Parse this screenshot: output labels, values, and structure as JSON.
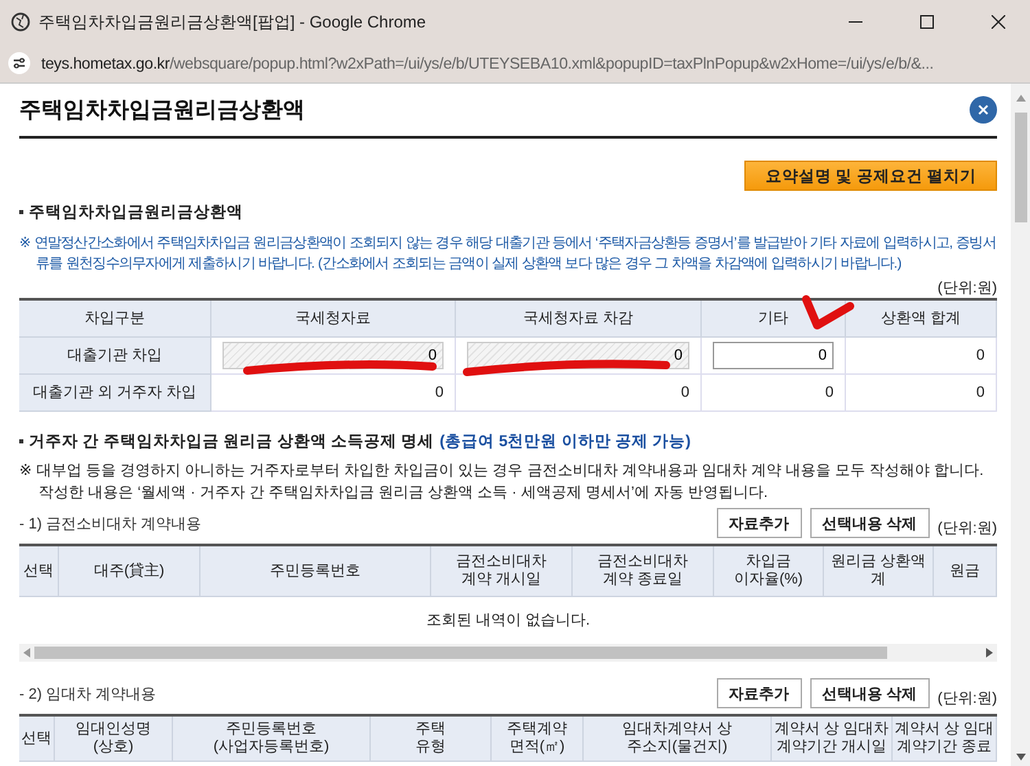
{
  "window": {
    "title": "주택임차차입금원리금상환액[팝업] - Google Chrome",
    "url_host": "teys.hometax.go.kr",
    "url_path": "/websquare/popup.html?w2xPath=/ui/ys/e/b/UTEYSEBA10.xml&popupID=taxPlnPopup&w2xHome=/ui/ys/e/b/&..."
  },
  "popup": {
    "title": "주택임차차입금원리금상환액",
    "summary_button": "요약설명 및 공제요건 펼치기"
  },
  "section1": {
    "title": "주택임차차입금원리금상환액",
    "notice": "※ 연말정산간소화에서 주택임차차입금 원리금상환액이 조회되지 않는 경우 해당 대출기관 등에서 ‘주택자금상환등 증명서’를 발급받아 기타 자료에 입력하시고, 증빙서류를 원천징수의무자에게 제출하시기 바랍니다. (간소화에서 조회되는 금액이 실제 상환액 보다 많은 경우 그 차액을 차감액에 입력하시기 바랍니다.)",
    "unit": "(단위:원)",
    "columns": [
      "차입구분",
      "국세청자료",
      "국세청자료 차감",
      "기타",
      "상환액 합계"
    ],
    "rows": [
      {
        "label": "대출기관 차입",
        "cells": [
          {
            "kind": "readonly",
            "value": "0"
          },
          {
            "kind": "readonly",
            "value": "0"
          },
          {
            "kind": "input",
            "value": "0"
          },
          {
            "kind": "text",
            "value": "0"
          }
        ]
      },
      {
        "label": "대출기관 외 거주자 차입",
        "cells": [
          {
            "kind": "text",
            "value": "0"
          },
          {
            "kind": "text",
            "value": "0"
          },
          {
            "kind": "text",
            "value": "0"
          },
          {
            "kind": "text",
            "value": "0"
          }
        ]
      }
    ]
  },
  "section2": {
    "title": "거주자 간 주택임차차입금 원리금 상환액 소득공제 명세",
    "title_note": "(총급여 5천만원 이하만 공제 가능)",
    "notes": [
      "※ 대부업 등을 경영하지 아니하는 거주자로부터 차입한 차입금이 있는 경우 금전소비대차 계약내용과 임대차 계약 내용을 모두 작성해야 합니다.",
      "작성한 내용은 ‘월세액 · 거주자 간 주택임차차입금 원리금 상환액 소득 · 세액공제 명세서’에 자동 반영됩니다."
    ],
    "loan_contract": {
      "label": "- 1) 금전소비대차 계약내용",
      "buttons": [
        "자료추가",
        "선택내용 삭제"
      ],
      "unit": "(단위:원)",
      "columns": [
        "선택",
        "대주(貸主)",
        "주민등록번호",
        "금전소비대차\n계약 개시일",
        "금전소비대차\n계약 종료일",
        "차입금\n이자율(%)",
        "원리금 상환액\n계",
        "원금"
      ],
      "empty_message": "조회된 내역이 없습니다."
    },
    "lease_contract": {
      "label": "- 2) 임대차 계약내용",
      "buttons": [
        "자료추가",
        "선택내용 삭제"
      ],
      "unit": "(단위:원)",
      "columns": [
        "선택",
        "임대인성명\n(상호)",
        "주민등록번호\n(사업자등록번호)",
        "주택\n유형",
        "주택계약\n면적(㎡)",
        "임대차계약서 상\n주소지(물건지)",
        "계약서 상 임대차\n계약기간 개시일",
        "계약서 상 임대\n계약기간 종료"
      ]
    }
  }
}
